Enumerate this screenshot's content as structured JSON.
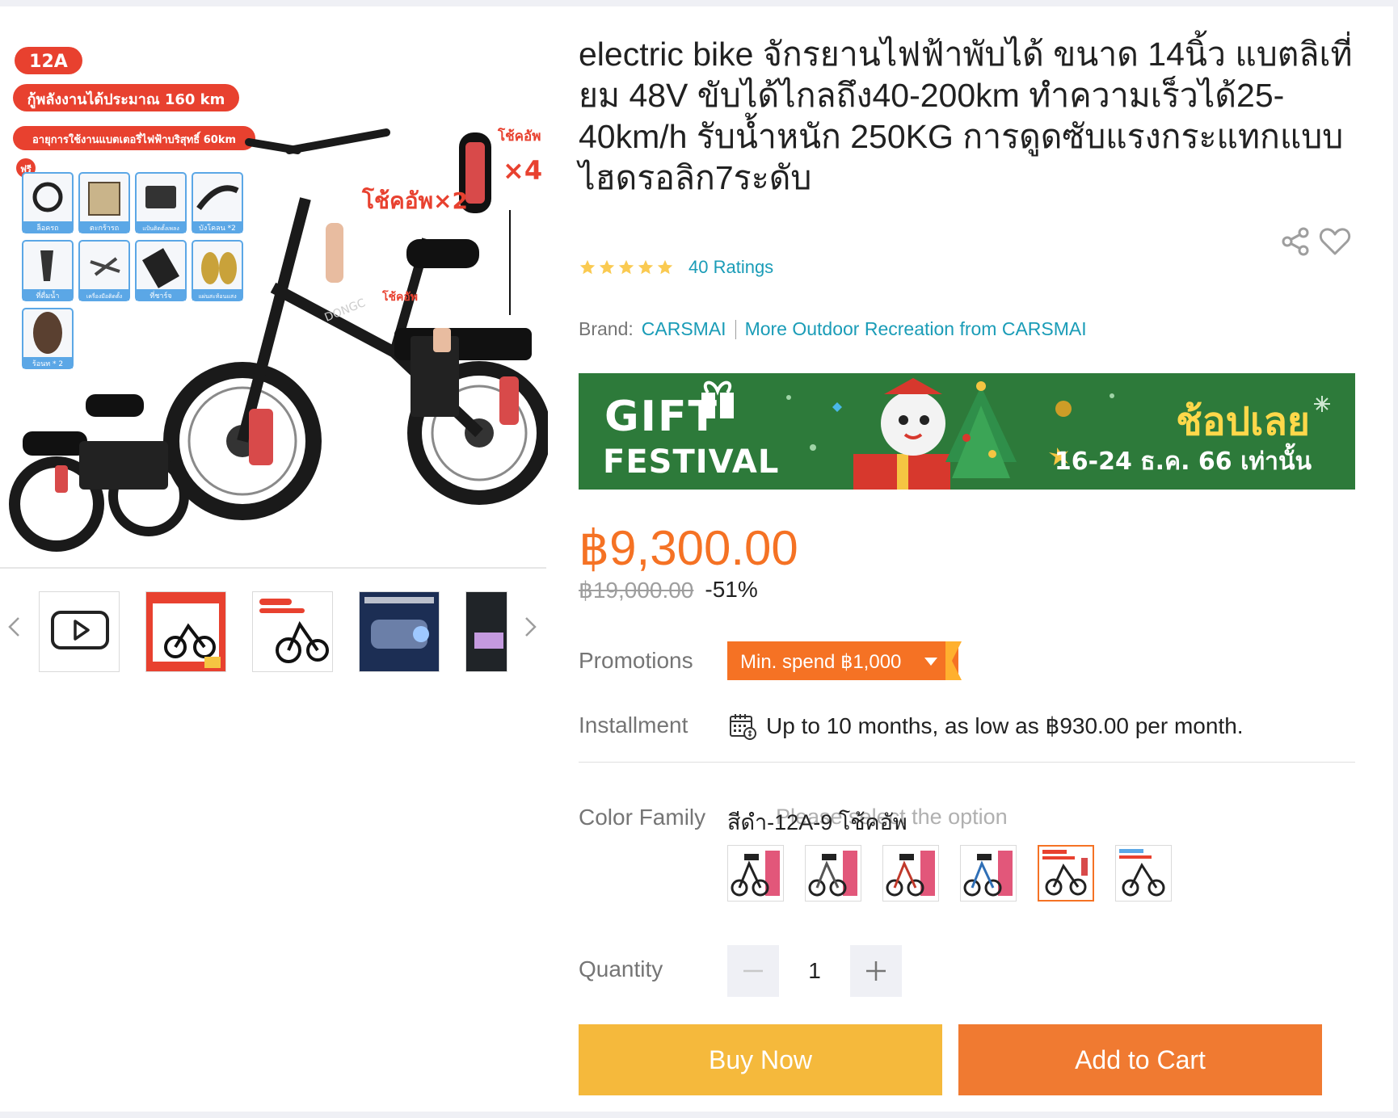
{
  "product": {
    "title": "electric bike จักรยานไฟฟ้าพับได้ ขนาด 14นิ้ว แบตลิเที่ยม 48V ขับได้ไกลถึง40-200km ทำความเร็วได้25-40km/h รับน้ำหนัก 250KG การดูดซับแรงกระแทกแบบไฮดรอลิก7ระดับ",
    "ratings_text": "40 Ratings",
    "star_count": 5,
    "brand_label": "Brand:",
    "brand_name": "CARSMAI",
    "more_link": "More Outdoor Recreation from CARSMAI"
  },
  "main_image": {
    "badge": "12A",
    "line1": "กู้พลังงานได้ประมาณ 160 km",
    "line2": "อายุการใช้งานแบตเตอรี่ไฟฟ้าบริสุทธิ์ 60km",
    "free_tag": "ฟรี",
    "accessories": [
      "ล็อครถ",
      "ตะกร้ารถ",
      "แป้นติดตั้งเพลง",
      "บังโคลน *2",
      "ที่ดื่มน้ำ",
      "เครื่องมือติดตั้ง",
      "ที่ชาร์จ",
      "แผ่นสะท้อนแสง",
      "ร้อนท * 2"
    ],
    "shock_label_a": "โช้คอัพ×2",
    "shock_label_b": "โช้คอัพ",
    "shock_label_c": "โช้คอัพ",
    "shock_count": "×4",
    "frame_text": "DONGC"
  },
  "banner": {
    "line1": "GIFT",
    "line2": "FESTIVAL",
    "cta": "ช้อปเลย",
    "dates": "16-24 ธ.ค. 66 เท่านั้น",
    "bg_color": "#2d7a3a"
  },
  "pricing": {
    "price": "฿9,300.00",
    "original": "฿19,000.00",
    "discount": "-51%"
  },
  "promotions": {
    "label": "Promotions",
    "tag": "Min. spend ฿1,000"
  },
  "installment": {
    "label": "Installment",
    "text": "Up to 10 months, as low as ฿930.00 per month."
  },
  "color_family": {
    "label": "Color Family",
    "selected": "สีดำ-12A-9 โช้คอัพ",
    "ghost_text": "Please select the option",
    "swatch_count": 6,
    "selected_index": 4
  },
  "quantity": {
    "label": "Quantity",
    "value": "1",
    "minus": "−",
    "plus": "+"
  },
  "actions": {
    "buy_now": "Buy Now",
    "add_to_cart": "Add to Cart"
  },
  "colors": {
    "accent": "#f57224",
    "link": "#1a9cb7",
    "buy_now": "#f5b93c",
    "add_to_cart": "#f07a31"
  }
}
